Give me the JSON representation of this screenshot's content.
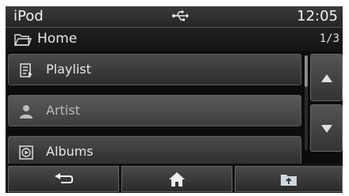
{
  "status": {
    "app_title": "iPod",
    "time": "12:05",
    "usb_icon": "usb-icon"
  },
  "path": {
    "label": "Home",
    "page": "1/3",
    "icon": "folder-icon"
  },
  "list": {
    "items": [
      {
        "label": "Playlist",
        "icon": "playlist-icon",
        "selected": false
      },
      {
        "label": "Artist",
        "icon": "artist-icon",
        "selected": true
      },
      {
        "label": "Albums",
        "icon": "album-icon",
        "selected": false
      }
    ]
  },
  "scroll": {
    "up_icon": "arrow-up-icon",
    "down_icon": "arrow-down-icon"
  },
  "bottom": {
    "back_icon": "back-icon",
    "home_icon": "home-icon",
    "folder_icon": "folder-up-icon"
  },
  "colors": {
    "background": "#0c0c0c",
    "row": "#3a3a3a",
    "text": "#e6e6e6"
  }
}
